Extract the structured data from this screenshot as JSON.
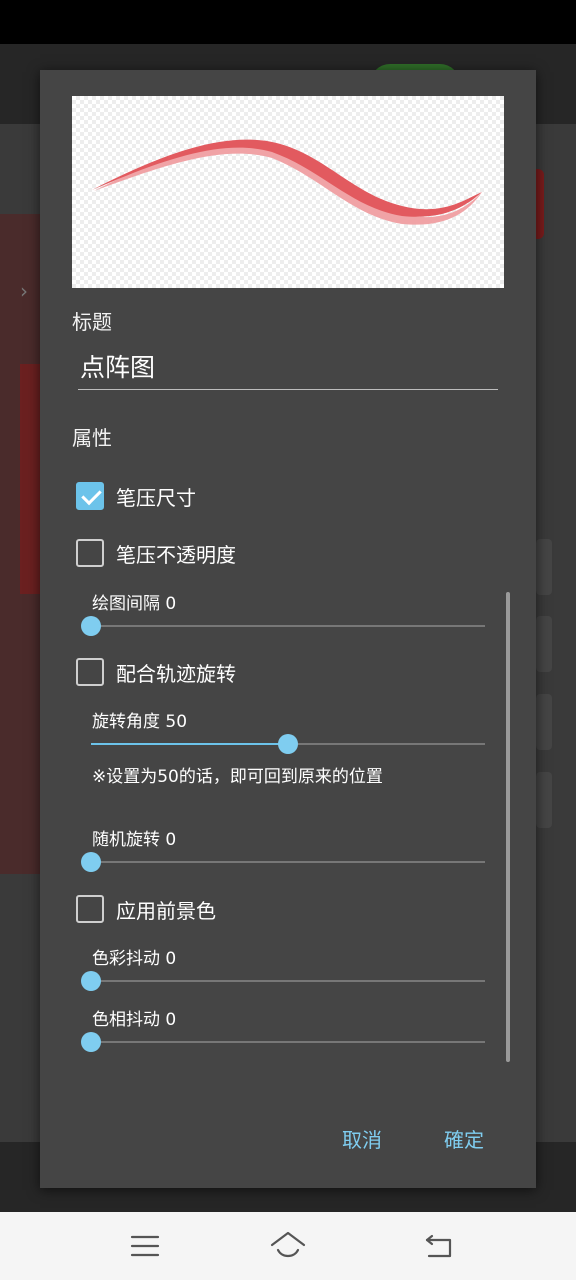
{
  "dialog": {
    "title_section_label": "标题",
    "title_value": "点阵图",
    "properties_section_label": "属性",
    "checkboxes": [
      {
        "label": "笔压尺寸",
        "checked": true
      },
      {
        "label": "笔压不透明度",
        "checked": false
      },
      {
        "label": "配合轨迹旋转",
        "checked": false
      },
      {
        "label": "应用前景色",
        "checked": false
      }
    ],
    "sliders": {
      "drawing_interval": {
        "label": "绘图间隔 0",
        "value": 0,
        "max": 100
      },
      "rotation_angle": {
        "label": "旋转角度 50",
        "value": 50,
        "max": 100
      },
      "random_rotation": {
        "label": "随机旋转 0",
        "value": 0,
        "max": 100
      },
      "color_jitter": {
        "label": "色彩抖动  0",
        "value": 0,
        "max": 100
      },
      "hue_jitter": {
        "label": "色相抖动  0",
        "value": 0,
        "max": 100
      }
    },
    "rotation_note": "※设置为50的话，即可回到原来的位置",
    "cancel_label": "取消",
    "ok_label": "確定"
  },
  "colors": {
    "accent": "#6cc3ea",
    "stroke_main": "#e25a5f",
    "stroke_shadow": "#f0a3a6",
    "dialog_bg": "#454545"
  },
  "nav": {
    "icons": [
      "menu-icon",
      "home-icon",
      "back-icon"
    ]
  }
}
